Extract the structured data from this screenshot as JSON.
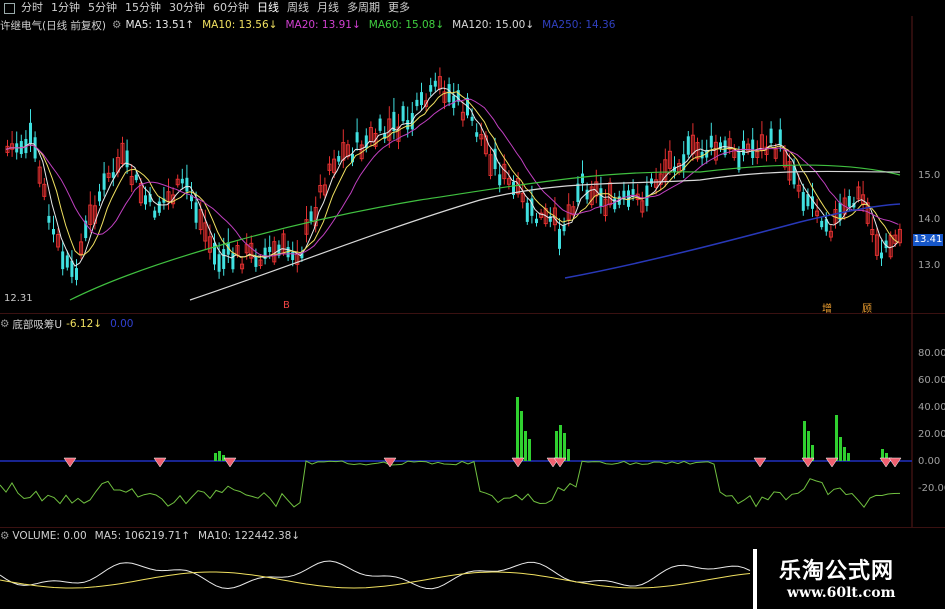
{
  "toolbar": {
    "items": [
      "分时",
      "1分钟",
      "5分钟",
      "15分钟",
      "30分钟",
      "60分钟",
      "日线",
      "周线",
      "月线",
      "多周期",
      "更多"
    ]
  },
  "main_panel": {
    "stock_title": "许继电气(日线 前复权)",
    "ma_legend": [
      {
        "label": "MA5: 13.51↑",
        "color": "#e8e8e8"
      },
      {
        "label": "MA10: 13.56↓",
        "color": "#f0e060"
      },
      {
        "label": "MA20: 13.91↓",
        "color": "#d040d0"
      },
      {
        "label": "MA60: 15.08↓",
        "color": "#40d040"
      },
      {
        "label": "MA120: 15.00↓",
        "color": "#d8d8d8"
      },
      {
        "label": "MA250: 14.36",
        "color": "#3040c0"
      }
    ],
    "y_axis": [
      "15.0",
      "14.0",
      "13.0"
    ],
    "current_price": "13.41",
    "low_label": "12.31",
    "markers": [
      "B",
      "增",
      "顾"
    ]
  },
  "indicator_panel": {
    "name": "底部吸筹U",
    "value": "-6.12↓",
    "value2": "0.00",
    "y_axis": [
      "80.00",
      "60.00",
      "40.00",
      "20.00",
      "0.00",
      "-20.00"
    ]
  },
  "volume_panel": {
    "legend": [
      "VOLUME: 0.00",
      "MA5: 106219.71↑",
      "MA10: 122442.38↓"
    ]
  },
  "watermark": {
    "title": "乐淘公式网",
    "url": "www.60lt.com"
  },
  "colors": {
    "up": "#e23030",
    "down": "#40e0e0",
    "ma5": "#e8e8e8",
    "ma10": "#f0e060",
    "ma20": "#c040c0",
    "ma60": "#40c040",
    "ma120": "#d8d8d8",
    "ma250": "#2838b8",
    "accum_bar": "#30d030",
    "accum_line": "#70c040",
    "zero_line": "#2030c0",
    "diamond": "#f06070"
  }
}
